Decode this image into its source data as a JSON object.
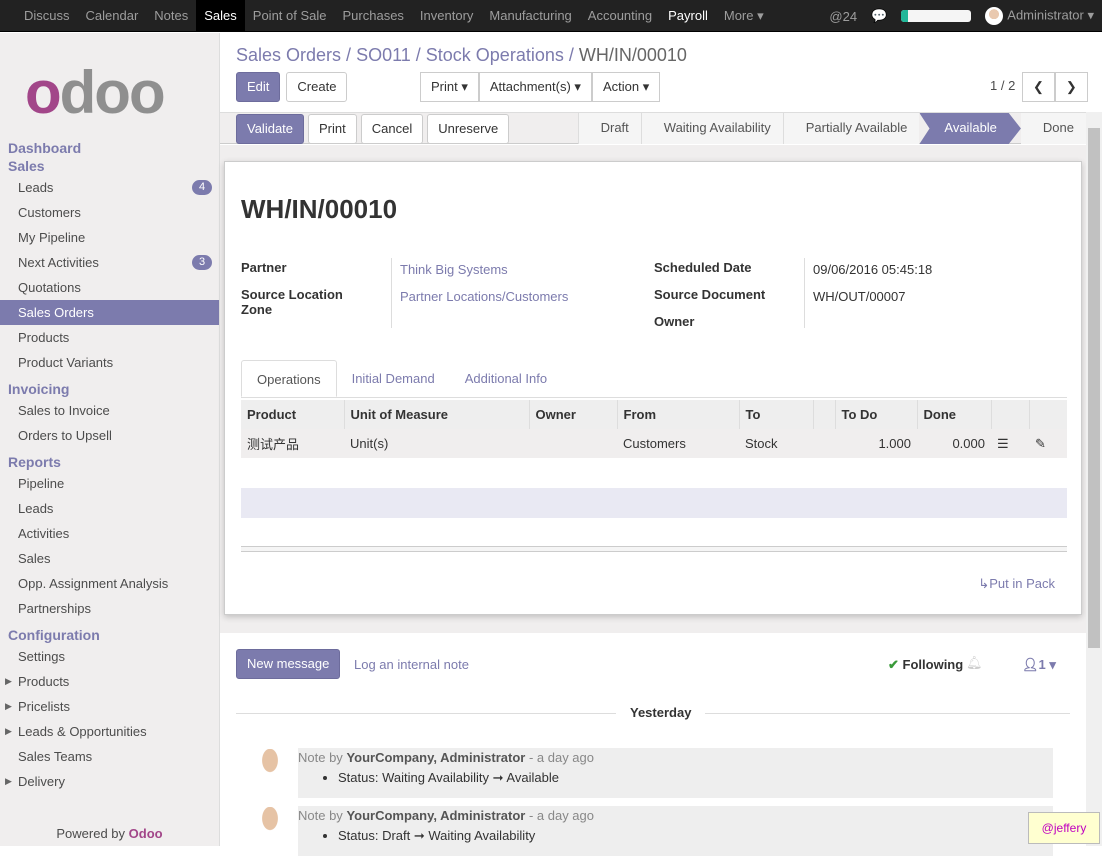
{
  "topnav": {
    "items": [
      "Discuss",
      "Calendar",
      "Notes",
      "Sales",
      "Point of Sale",
      "Purchases",
      "Inventory",
      "Manufacturing",
      "Accounting",
      "Payroll",
      "More"
    ],
    "mentions": "24",
    "progress": 0.1,
    "user": "Administrator"
  },
  "sidebar": {
    "sections": [
      {
        "title": "Dashboard",
        "items": []
      },
      {
        "title": "Sales",
        "items": [
          {
            "label": "Leads",
            "badge": "4"
          },
          {
            "label": "Customers"
          },
          {
            "label": "My Pipeline"
          },
          {
            "label": "Next Activities",
            "badge": "3"
          },
          {
            "label": "Quotations"
          },
          {
            "label": "Sales Orders",
            "active": true
          },
          {
            "label": "Products"
          },
          {
            "label": "Product Variants"
          }
        ]
      },
      {
        "title": "Invoicing",
        "items": [
          {
            "label": "Sales to Invoice"
          },
          {
            "label": "Orders to Upsell"
          }
        ]
      },
      {
        "title": "Reports",
        "items": [
          {
            "label": "Pipeline"
          },
          {
            "label": "Leads"
          },
          {
            "label": "Activities"
          },
          {
            "label": "Sales"
          },
          {
            "label": "Opp. Assignment Analysis"
          },
          {
            "label": "Partnerships"
          }
        ]
      },
      {
        "title": "Configuration",
        "items": [
          {
            "label": "Settings"
          },
          {
            "label": "Products",
            "caret": true
          },
          {
            "label": "Pricelists",
            "caret": true
          },
          {
            "label": "Leads & Opportunities",
            "caret": true
          },
          {
            "label": "Sales Teams"
          },
          {
            "label": "Delivery",
            "caret": true
          }
        ]
      }
    ],
    "powered_by": "Powered by",
    "brand": "Odoo"
  },
  "breadcrumb": [
    "Sales Orders",
    "SO011",
    "Stock Operations",
    "WH/IN/00010"
  ],
  "toolbar": {
    "edit": "Edit",
    "create": "Create",
    "print": "Print",
    "attachments": "Attachment(s)",
    "action": "Action",
    "pager": "1 / 2"
  },
  "statusbar": {
    "buttons": [
      "Validate",
      "Print",
      "Cancel",
      "Unreserve"
    ],
    "stages": [
      "Draft",
      "Waiting Availability",
      "Partially Available",
      "Available",
      "Done"
    ],
    "current": "Available"
  },
  "form": {
    "title": "WH/IN/00010",
    "partner_label": "Partner",
    "partner": "Think Big Systems",
    "source_location_label": "Source Location Zone",
    "source_location": "Partner Locations/Customers",
    "scheduled_date_label": "Scheduled Date",
    "scheduled_date": "09/06/2016 05:45:18",
    "source_document_label": "Source Document",
    "source_document": "WH/OUT/00007",
    "owner_label": "Owner"
  },
  "tabs": [
    "Operations",
    "Initial Demand",
    "Additional Info"
  ],
  "table": {
    "headers": [
      "Product",
      "Unit of Measure",
      "Owner",
      "From",
      "To",
      "",
      "To Do",
      "Done"
    ],
    "rows": [
      {
        "product": "测试产品",
        "uom": "Unit(s)",
        "owner": "",
        "from": "Customers",
        "to": "Stock",
        "todo": "1.000",
        "done": "0.000"
      }
    ]
  },
  "put_in_pack": "Put in Pack",
  "chatter": {
    "new_message": "New message",
    "log_note": "Log an internal note",
    "following": "Following",
    "followers": "1",
    "date_sep": "Yesterday",
    "messages": [
      {
        "prefix": "Note by",
        "author": "YourCompany, Administrator",
        "time": "- a day ago",
        "change": "Status: Waiting Availability ➞ Available"
      },
      {
        "prefix": "Note by",
        "author": "YourCompany, Administrator",
        "time": "- a day ago",
        "change": "Status: Draft ➞ Waiting Availability"
      }
    ]
  },
  "watermark": "@jeffery"
}
